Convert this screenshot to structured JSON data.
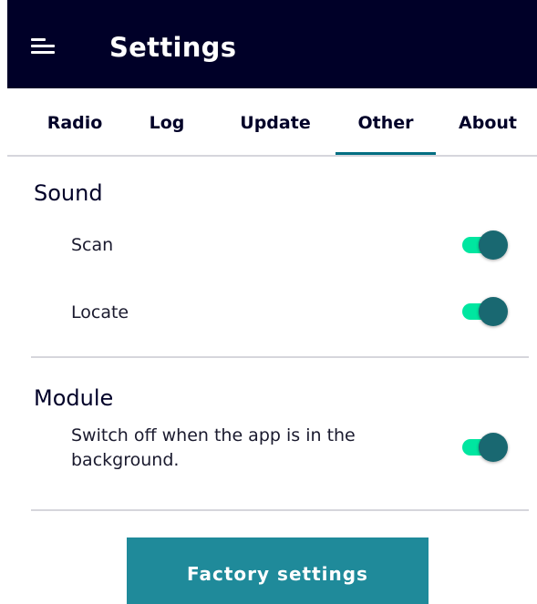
{
  "app_bar": {
    "title": "Settings",
    "menu_icon": "hamburger-menu-icon",
    "background_color": "#000028"
  },
  "tabs": {
    "items": [
      {
        "label": "Radio",
        "selected": false
      },
      {
        "label": "Log",
        "selected": false
      },
      {
        "label": "Update",
        "selected": false
      },
      {
        "label": "Other",
        "selected": true
      },
      {
        "label": "About",
        "selected": false
      }
    ],
    "indicator_color": "#006e82"
  },
  "sound": {
    "title": "Sound",
    "rows": [
      {
        "label": "Scan",
        "enabled": true
      },
      {
        "label": "Locate",
        "enabled": true
      }
    ]
  },
  "module": {
    "title": "Module",
    "rows": [
      {
        "label": "Switch off when the app is in the background.",
        "enabled": true
      }
    ]
  },
  "toggle_colors": {
    "track_on": "#00e6a0",
    "thumb_on": "#196871"
  },
  "factory_button": {
    "label": "Factory settings",
    "color": "#1f8a9a"
  }
}
